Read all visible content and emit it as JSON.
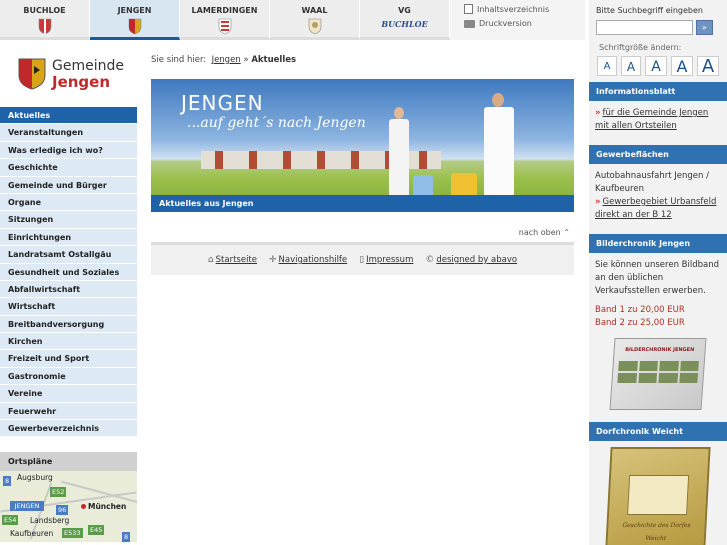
{
  "topnav": {
    "tabs": [
      {
        "label": "BUCHLOE",
        "color": "#c83a3a"
      },
      {
        "label": "JENGEN",
        "color": "#d8a418"
      },
      {
        "label": "LAMERDINGEN",
        "color": "#c83a3a"
      },
      {
        "label": "WAAL",
        "color": "#b0a070"
      },
      {
        "label": "VG",
        "sub": "BUCHLOE"
      }
    ],
    "active_tab": "JENGEN",
    "tools": {
      "sitemap": "Inhaltsverzeichnis",
      "print": "Druckversion"
    }
  },
  "search": {
    "label": "Bitte Suchbegriff eingeben",
    "value": "",
    "button": "»"
  },
  "fontsize": {
    "label": "Schriftgröße ändern:",
    "buttons": [
      "A",
      "A",
      "A",
      "A",
      "A"
    ]
  },
  "logo": {
    "line1": "Gemeinde",
    "line2": "Jengen"
  },
  "menu": [
    "Aktuelles",
    "Veranstaltungen",
    "Was erledige ich wo?",
    "Geschichte",
    "Gemeinde und Bürger",
    "Organe",
    "Sitzungen",
    "Einrichtungen",
    "Landratsamt Ostallgäu",
    "Gesundheit und Soziales",
    "Abfallwirtschaft",
    "Wirtschaft",
    "Breitbandversorgung",
    "Kirchen",
    "Freizeit und Sport",
    "Gastronomie",
    "Vereine",
    "Feuerwehr",
    "Gewerbeverzeichnis"
  ],
  "ortsplaene": {
    "heading": "Ortspläne",
    "labels": {
      "augsburg": "Augsburg",
      "muenchen": "München",
      "landsberg": "Landsberg",
      "kaufbeuren": "Kaufbeuren",
      "jengen": "JENGEN"
    },
    "shields": {
      "s8a": "8",
      "e52": "E52",
      "s96": "96",
      "e54": "E54",
      "e533": "E533",
      "e45": "E45",
      "s8b": "8"
    }
  },
  "breadcrumb": {
    "prefix": "Sie sind hier:",
    "link": "Jengen",
    "sep": "»",
    "current": "Aktuelles"
  },
  "banner": {
    "title": "JENGEN",
    "subtitle": "...auf geht´s nach Jengen",
    "caption": "Aktuelles aus Jengen"
  },
  "nach_oben": "nach oben ⌃",
  "footer": {
    "start": "Startseite",
    "nav": "Navigationshilfe",
    "impressum": "Impressum",
    "designed": "designed by abavo"
  },
  "right": {
    "info": {
      "heading": "Informationsblatt",
      "link": "für die Gemeinde Jengen mit allen Ortsteilen"
    },
    "gewerbe": {
      "heading": "Gewerbeflächen",
      "text": "Autobahnausfahrt Jengen / Kaufbeuren",
      "link": "Gewerbegebiet Urbansfeld direkt an der B 12"
    },
    "bilder": {
      "heading": "Bilderchronik Jengen",
      "text": "Sie können unseren Bildband an den üblichen Verkaufsstellen erwerben.",
      "band1": "Band 1 zu 20,00 EUR",
      "band2": "Band 2 zu 25,00 EUR",
      "book_title": "BILDERCHRONIK JENGEN"
    },
    "dorf": {
      "heading": "Dorfchronik Weicht",
      "book_title": "Geschichte des Dorfes Weicht"
    }
  },
  "colors": {
    "accent": "#1e62a8",
    "menu_bg": "#dde9f4",
    "red": "#c0282c"
  }
}
